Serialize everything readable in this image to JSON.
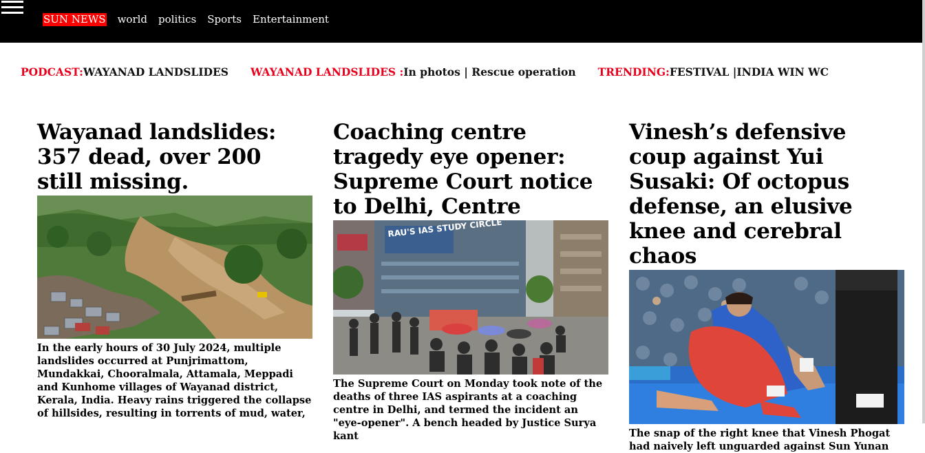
{
  "header": {
    "brand": "SUN NEWS",
    "nav": [
      "world",
      "politics",
      "Sports",
      "Entertainment"
    ]
  },
  "ticker": [
    {
      "label": "PODCAST:",
      "text": "WAYANAD LANDSLIDES"
    },
    {
      "label": "WAYANAD LANDSLIDES :",
      "text": "In photos | Rescue operation"
    },
    {
      "label": "TRENDING:",
      "text": "FESTIVAL |INDIA WIN WC"
    }
  ],
  "articles": [
    {
      "headline": "Wayanad landslides: 357 dead, over 200 still missing.",
      "summary": "In the early hours of 30 July 2024, multiple landslides occurred at Punjrimattom, Mundakkai, Chooralmala, Attamala, Meppadi and Kunhome villages of Wayanad district, Kerala, India. Heavy rains triggered the collapse of hillsides, resulting in torrents of mud, water,"
    },
    {
      "headline": "Coaching centre tragedy eye opener: Supreme Court notice to Delhi, Centre",
      "photo_sign": "RAU'S IAS STUDY CIRCLE",
      "summary": "The Supreme Court on Monday took note of the deaths of three IAS aspirants at a coaching centre in Delhi, and termed the incident an \"eye-opener\". A bench headed by Justice Surya kant"
    },
    {
      "headline": "Vinesh’s defensive coup against Yui Susaki: Of octopus defense, an elusive knee and cerebral chaos",
      "summary": "The snap of the right knee that Vinesh Phogat had naively left unguarded against Sun Yunan"
    }
  ],
  "colors": {
    "topbar": "#000000",
    "brand_bg": "#ff0000",
    "ticker_label": "#e8001c"
  }
}
